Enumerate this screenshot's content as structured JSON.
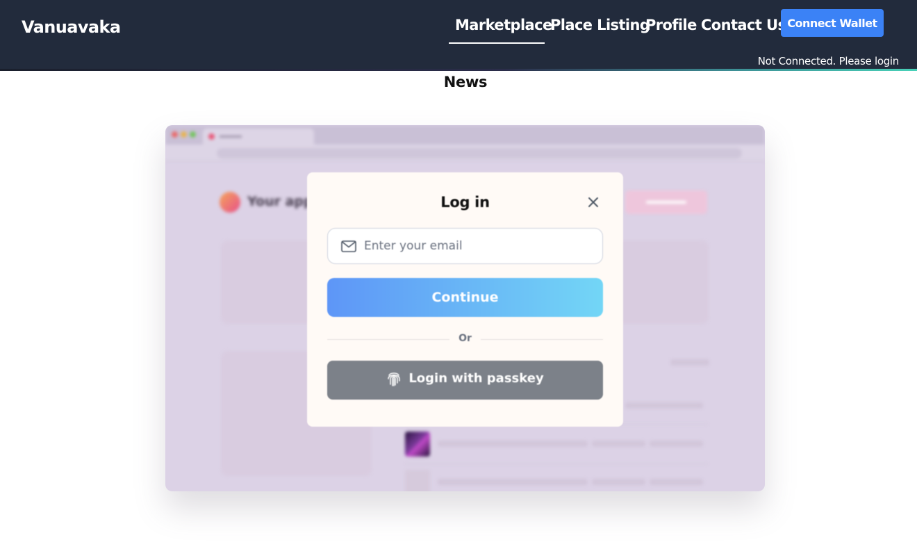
{
  "header": {
    "brand": "Vanuavaka",
    "nav": [
      {
        "label": "Marketplace",
        "active": true
      },
      {
        "label": "Place Listing",
        "active": false
      },
      {
        "label": "Profile",
        "active": false
      },
      {
        "label": "Contact Us",
        "active": false
      }
    ],
    "connect_button": "Connect Wallet",
    "status": "Not Connected. Please login"
  },
  "colors": {
    "header_bg": "#222b3c",
    "accent_blue": "#3b82f6",
    "continue_gradient": [
      "#5e96f7",
      "#73d6f6"
    ],
    "passkey_button": "#7c8189"
  },
  "main": {
    "section_title": "News",
    "news_image": {
      "app_name": "Your app",
      "modal": {
        "title": "Log in",
        "email_placeholder": "Enter your email",
        "continue_label": "Continue",
        "divider_label": "Or",
        "passkey_label": "Login with passkey",
        "icons": [
          "close-icon",
          "mail-icon",
          "fingerprint-icon"
        ]
      }
    }
  }
}
